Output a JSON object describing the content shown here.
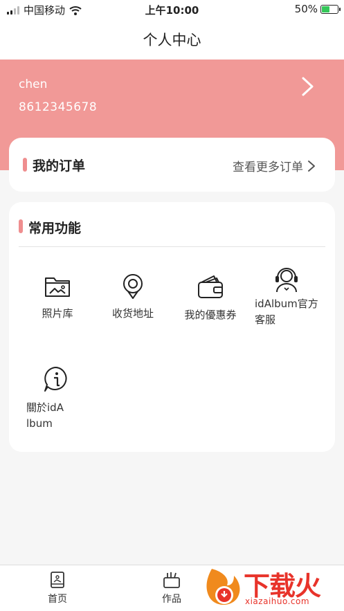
{
  "status_bar": {
    "carrier": "中国移动",
    "time": "上午10:00",
    "battery": "50%",
    "battery_level": 0.5,
    "icons": [
      "signal-icon",
      "wifi-icon",
      "battery-icon"
    ]
  },
  "nav": {
    "title": "个人中心"
  },
  "profile": {
    "name": "chen",
    "phone": "8612345678",
    "background_color": "#f19997"
  },
  "orders": {
    "title": "我的订单",
    "more_label": "查看更多订单"
  },
  "features": {
    "title": "常用功能",
    "items": [
      {
        "label": "照片库",
        "icon": "photo-folder-icon"
      },
      {
        "label": "收货地址",
        "icon": "location-pin-icon"
      },
      {
        "label": "我的優惠券",
        "icon": "wallet-icon"
      },
      {
        "label": "idAlbum官方客服",
        "icon": "customer-service-icon"
      },
      {
        "label": "關於idAlbum",
        "icon": "info-bubble-icon"
      }
    ]
  },
  "tabbar": {
    "tabs": [
      {
        "label": "首页",
        "icon": "album-book-icon"
      },
      {
        "label": "作品",
        "icon": "works-box-icon"
      }
    ]
  },
  "watermark": {
    "brand": "下载火",
    "domain": "xiazaihuo.com"
  },
  "colors": {
    "accent": "#ef8e8f",
    "watermark": "#e8332a"
  }
}
